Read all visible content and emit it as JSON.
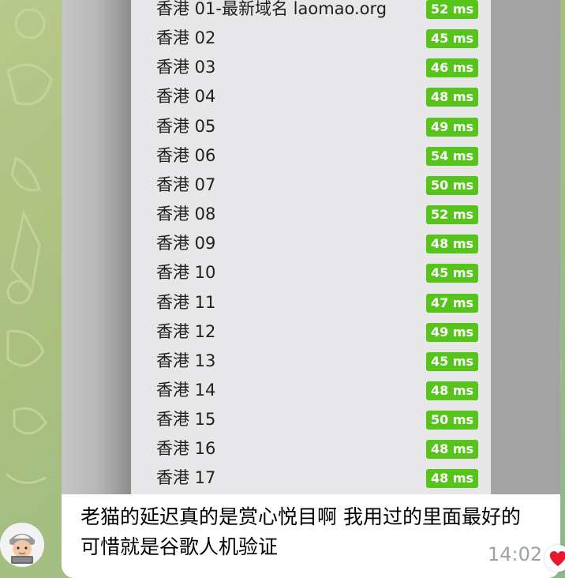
{
  "servers": [
    {
      "name": "香港 01-最新域名 laomao.org",
      "latency": "52 ms"
    },
    {
      "name": "香港 02",
      "latency": "45 ms"
    },
    {
      "name": "香港 03",
      "latency": "46 ms"
    },
    {
      "name": "香港 04",
      "latency": "48 ms"
    },
    {
      "name": "香港 05",
      "latency": "49 ms"
    },
    {
      "name": "香港 06",
      "latency": "54 ms"
    },
    {
      "name": "香港 07",
      "latency": "50 ms"
    },
    {
      "name": "香港 08",
      "latency": "52 ms"
    },
    {
      "name": "香港 09",
      "latency": "48 ms"
    },
    {
      "name": "香港 10",
      "latency": "45 ms"
    },
    {
      "name": "香港 11",
      "latency": "47 ms"
    },
    {
      "name": "香港 12",
      "latency": "49 ms"
    },
    {
      "name": "香港 13",
      "latency": "45 ms"
    },
    {
      "name": "香港 14",
      "latency": "48 ms"
    },
    {
      "name": "香港 15",
      "latency": "50 ms"
    },
    {
      "name": "香港 16",
      "latency": "48 ms"
    },
    {
      "name": "香港 17",
      "latency": "48 ms"
    }
  ],
  "message": {
    "caption": "老猫的延迟真的是赏心悦目啊 我用过的里面最好的 可惜就是谷歌人机验证",
    "time": "14:02",
    "reaction": "heart-icon"
  },
  "colors": {
    "latency_badge": "#56c41a",
    "timestamp": "#9aa3a8",
    "reaction": "#e8182c"
  }
}
